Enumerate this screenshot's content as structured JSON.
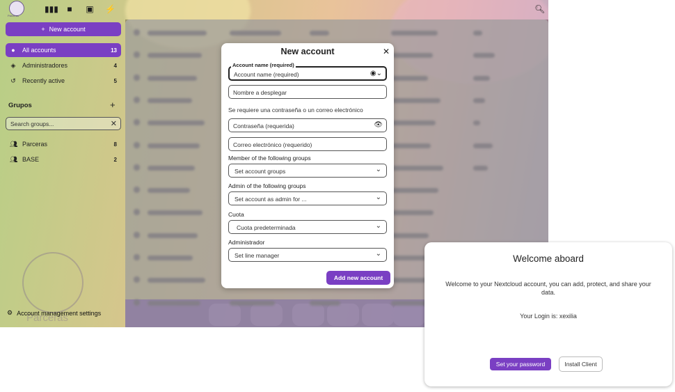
{
  "header": {
    "logo_text": "Parceras",
    "icons": [
      "dashboard-icon",
      "files-icon",
      "photos-icon",
      "activity-icon",
      "search-icon"
    ]
  },
  "sidebar": {
    "new_account_label": "New account",
    "items": [
      {
        "label": "All accounts",
        "count": "13",
        "icon": "user-icon"
      },
      {
        "label": "Administradores",
        "count": "4",
        "icon": "shield-icon"
      },
      {
        "label": "Recently active",
        "count": "5",
        "icon": "history-icon"
      }
    ],
    "groups_title": "Grupos",
    "groups_search_placeholder": "Search groups...",
    "groups": [
      {
        "label": "Parceras",
        "count": "8",
        "icon": "group-icon"
      },
      {
        "label": "BASE",
        "count": "2",
        "icon": "group-icon"
      }
    ],
    "settings_label": "Account management settings",
    "watermark_text": "Parceras"
  },
  "modal": {
    "title": "New account",
    "account_name_legend": "Account name (required)",
    "account_name_placeholder": "Account name (required)",
    "display_name_placeholder": "Nombre a desplegar",
    "password_hint": "Se requiere una contraseña o un correo electrónico",
    "password_placeholder": "Contraseña (requerida)",
    "email_placeholder": "Correo electrónico (requerido)",
    "member_groups_label": "Member of the following groups",
    "member_groups_value": "Set account groups",
    "admin_groups_label": "Admin of the following groups",
    "admin_groups_value": "Set account as admin for ...",
    "quota_label": "Cuota",
    "quota_value": "Cuota predeterminada",
    "manager_label": "Administrador",
    "manager_value": "Set line manager",
    "submit_label": "Add new account"
  },
  "welcome": {
    "title": "Welcome aboard",
    "text": "Welcome to your Nextcloud account, you can add, protect, and share your data.",
    "login_text": "Your Login is: xexilia",
    "set_password_label": "Set your password",
    "install_client_label": "Install Client"
  },
  "colors": {
    "accent": "#7a3fc3",
    "brand_band": "#6a2fb5"
  }
}
